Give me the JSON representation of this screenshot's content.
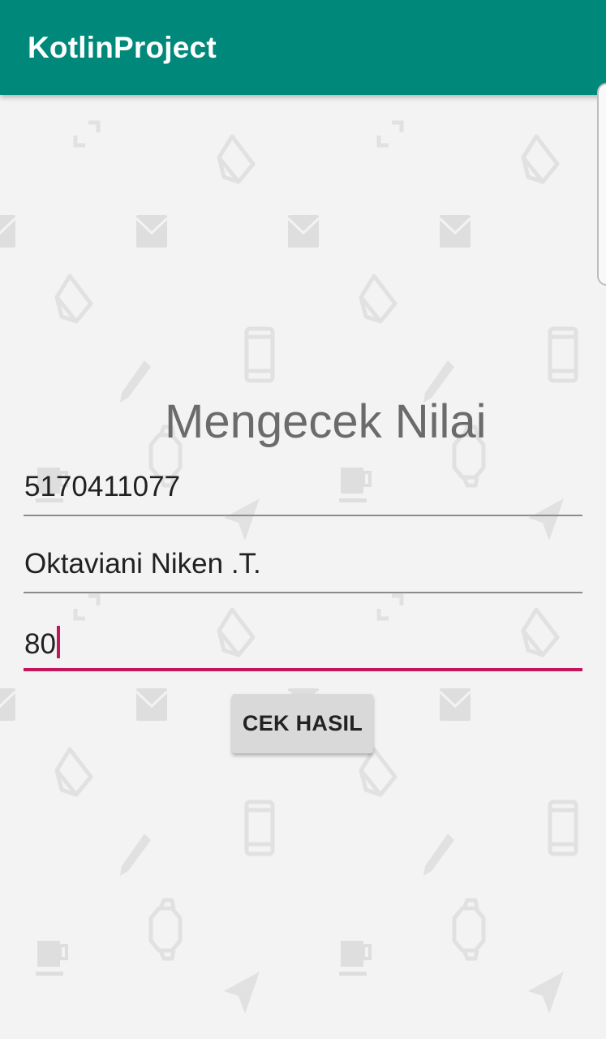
{
  "app": {
    "title": "KotlinProject",
    "colors": {
      "appbar": "#00897b",
      "accent": "#c2185b",
      "background": "#f3f3f3"
    }
  },
  "main": {
    "heading": "Mengecek Nilai",
    "fields": {
      "nim": {
        "value": "5170411077"
      },
      "name": {
        "value": "Oktaviani Niken .T."
      },
      "score": {
        "value": "80"
      }
    },
    "button_label": "CEK HASIL"
  },
  "wallpaper": {
    "pattern_icons": [
      "expand-icon",
      "tag-icon",
      "mail-icon",
      "phone-icon",
      "pencil-icon",
      "watch-icon",
      "mug-icon",
      "send-icon"
    ]
  }
}
